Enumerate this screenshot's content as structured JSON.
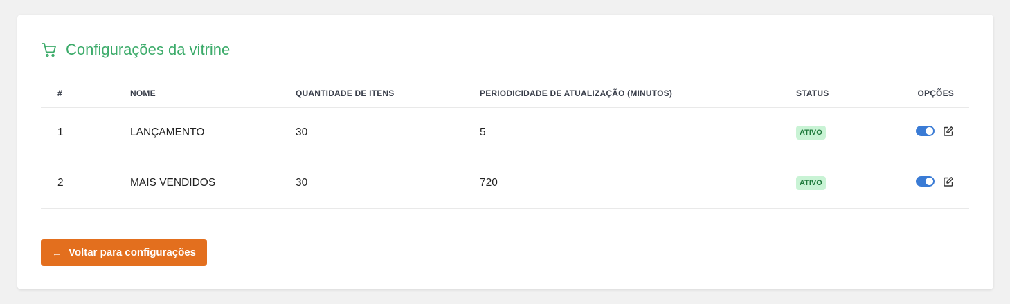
{
  "card": {
    "title": "Configurações da vitrine",
    "icon": "cart-icon"
  },
  "table": {
    "headers": [
      "#",
      "NOME",
      "QUANTIDADE DE ITENS",
      "PERIODICIDADE DE ATUALIZAÇÃO (MINUTOS)",
      "STATUS",
      "OPÇÕES"
    ],
    "rows": [
      {
        "idx": "1",
        "nome": "LANÇAMENTO",
        "quantidade": "30",
        "periodicidade": "5",
        "status": "ATIVO",
        "enabled": true
      },
      {
        "idx": "2",
        "nome": "MAIS VENDIDOS",
        "quantidade": "30",
        "periodicidade": "720",
        "status": "ATIVO",
        "enabled": true
      }
    ]
  },
  "actions": {
    "back_label": "Voltar para configurações",
    "back_icon": "arrow-left-icon"
  },
  "colors": {
    "title": "#3cab6a",
    "badge_bg": "#c9f3d5",
    "badge_text": "#1f7a3c",
    "toggle": "#3a7bd5",
    "button": "#e36f1e"
  }
}
